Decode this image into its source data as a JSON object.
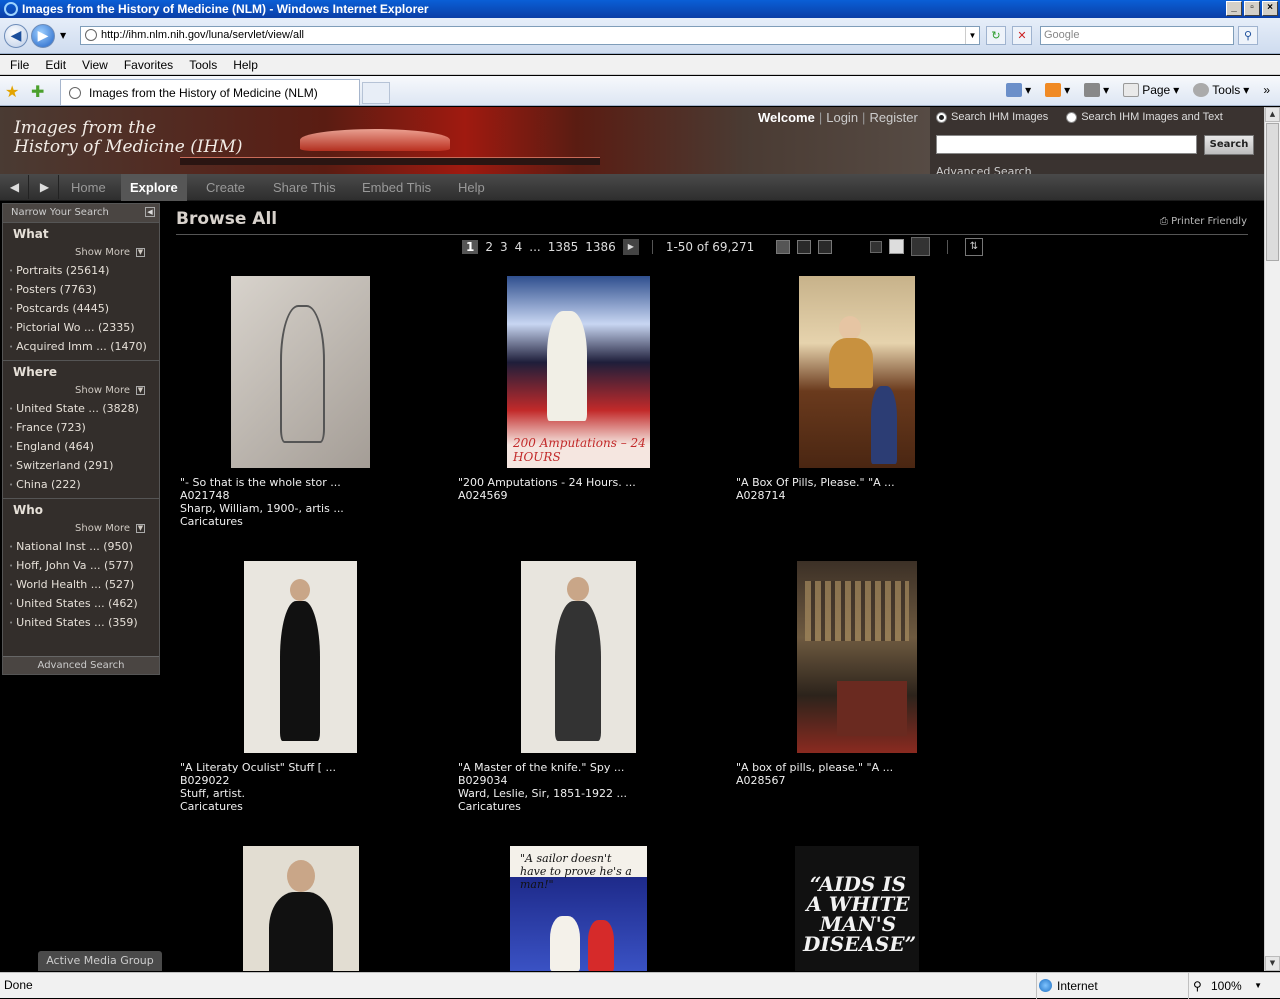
{
  "window": {
    "title": "Images from the History of Medicine (NLM) - Windows Internet Explorer",
    "buttons": [
      "_",
      "▫",
      "×"
    ]
  },
  "address": {
    "url": "http://ihm.nlm.nih.gov/luna/servlet/view/all",
    "search_placeholder": "Google"
  },
  "menu": [
    "File",
    "Edit",
    "View",
    "Favorites",
    "Tools",
    "Help"
  ],
  "tab": {
    "title": "Images from the History of Medicine (NLM)"
  },
  "commandbar": {
    "page_label": "Page",
    "tools_label": "Tools"
  },
  "site": {
    "banner_title_line1": "Images from the",
    "banner_title_line2": "History of Medicine (IHM)",
    "welcome": "Welcome",
    "login": "Login",
    "register": "Register",
    "search_option_1": "Search IHM Images",
    "search_option_2": "Search IHM Images and Text",
    "search_button": "Search",
    "advanced_search_top": "Advanced Search",
    "nav_tabs": [
      "Home",
      "Explore",
      "Create",
      "Share This",
      "Embed This",
      "Help"
    ],
    "active_tab": "Explore"
  },
  "sidebar": {
    "header": "Narrow Your Search",
    "show_more": "Show More",
    "what": {
      "title": "What",
      "items": [
        "Portraits (25614)",
        "Posters (7763)",
        "Postcards (4445)",
        "Pictorial Wo ... (2335)",
        "Acquired Imm ... (1470)"
      ]
    },
    "where": {
      "title": "Where",
      "items": [
        "United State ... (3828)",
        "France (723)",
        "England (464)",
        "Switzerland (291)",
        "China (222)"
      ]
    },
    "who": {
      "title": "Who",
      "items": [
        "National Inst ... (950)",
        "Hoff, John Va ... (577)",
        "World Health ... (527)",
        "United States ... (462)",
        "United States ... (359)"
      ]
    },
    "advanced_search": "Advanced Search"
  },
  "main": {
    "title": "Browse All",
    "printer_friendly": "Printer Friendly",
    "pages": [
      "1",
      "2",
      "3",
      "4",
      "...",
      "1385",
      "1386"
    ],
    "current_page": "1",
    "range": "1-50 of 69,271"
  },
  "items": [
    {
      "line1": "\"- So that is the whole stor ...",
      "line2": "A021748",
      "line3": "Sharp, William, 1900-, artis ...",
      "line4": "Caricatures"
    },
    {
      "line1": "\"200 Amputations - 24 Hours. ...",
      "line2": "A024569",
      "line3": "",
      "line4": "",
      "thumb_text": "200 Amputations – 24 HOURS"
    },
    {
      "line1": "\"A Box Of Pills, Please.\" \"A ...",
      "line2": "A028714",
      "line3": "",
      "line4": ""
    },
    {
      "line1": "\"A Literaty Oculist\" Stuff [ ...",
      "line2": "B029022",
      "line3": "Stuff, artist.",
      "line4": "Caricatures"
    },
    {
      "line1": "\"A Master of the knife.\" Spy ...",
      "line2": "B029034",
      "line3": "Ward, Leslie, Sir, 1851-1922 ...",
      "line4": "Caricatures"
    },
    {
      "line1": "\"A box of pills, please.\" \"A ...",
      "line2": "A028567",
      "line3": "",
      "line4": ""
    },
    {
      "thumb_text": ""
    },
    {
      "thumb_text": "\"A sailor doesn't have to prove he's a man!\""
    },
    {
      "thumb_text": "“AIDS IS A WHITE MAN'S DISEASE”"
    }
  ],
  "footer": {
    "active_media_group": "Active Media Group"
  },
  "status": {
    "left": "Done",
    "zone": "Internet",
    "zoom": "100%"
  }
}
